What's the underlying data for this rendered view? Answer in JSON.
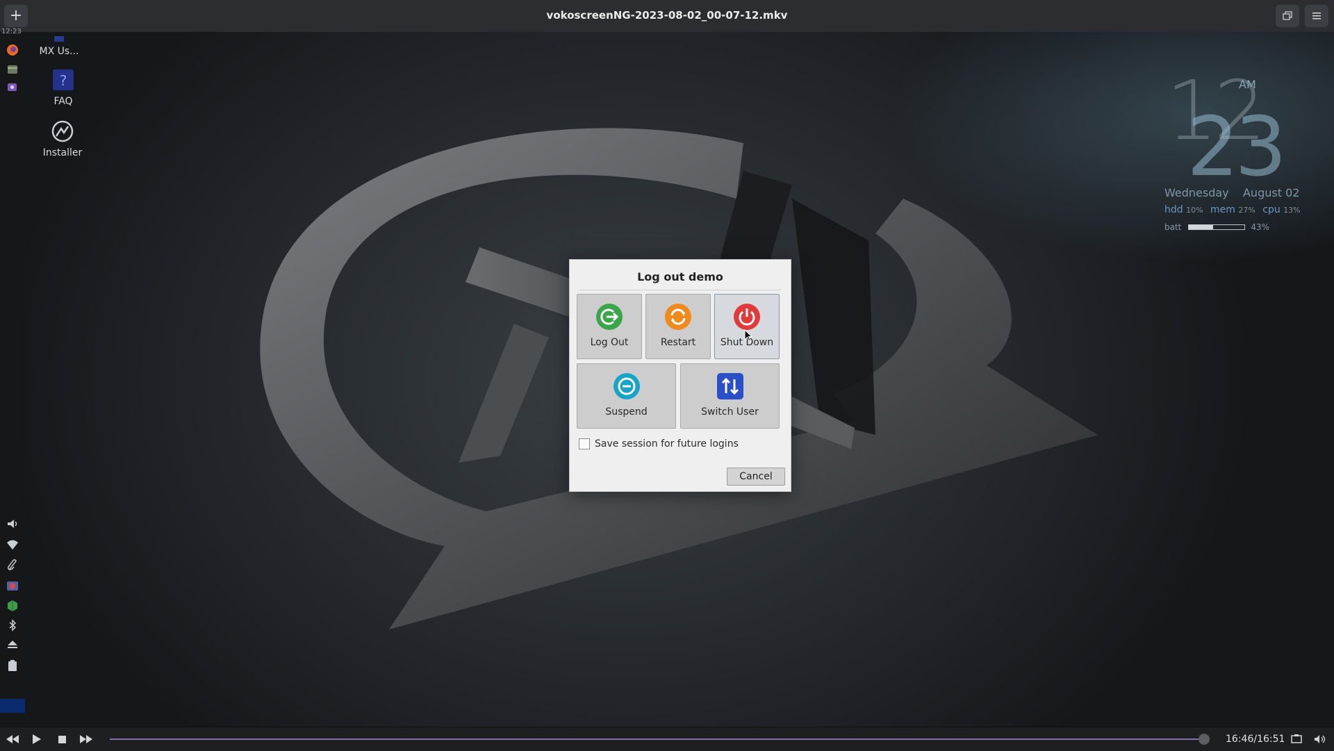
{
  "player": {
    "title": "vokoscreenNG-2023-08-02_00-07-12.mkv",
    "add_label": "+",
    "time": "16:46/16:51",
    "progress": 0.997
  },
  "panel": {
    "top_clock": "12:23"
  },
  "desktop": {
    "icons": [
      {
        "label": "MX Us...",
        "icon": "mx-user-manual-icon"
      },
      {
        "label": "FAQ",
        "icon": "faq-icon"
      },
      {
        "label": "Installer",
        "icon": "installer-icon"
      }
    ],
    "conky": {
      "hour": "12",
      "minute": "23",
      "ampm": "AM",
      "weekday": "Wednesday",
      "date": "August 02",
      "hdd_label": "hdd",
      "hdd_value": "10%",
      "mem_label": "mem",
      "mem_value": "27%",
      "cpu_label": "cpu",
      "cpu_value": "13%",
      "batt_label": "batt",
      "batt_value": "43%",
      "batt_level": 0.43
    }
  },
  "dialog": {
    "title": "Log out demo",
    "actions": [
      {
        "label": "Log Out",
        "icon": "logout-icon",
        "color": "#3aa64a"
      },
      {
        "label": "Restart",
        "icon": "restart-icon",
        "color": "#f08a1c"
      },
      {
        "label": "Shut Down",
        "icon": "power-icon",
        "color": "#e23a3a"
      },
      {
        "label": "Suspend",
        "icon": "suspend-icon",
        "color": "#18a3c9"
      },
      {
        "label": "Switch User",
        "icon": "switch-user-icon",
        "color": "#2b4fc9"
      }
    ],
    "save_session_label": "Save session for future logins",
    "save_session_checked": false,
    "cancel_label": "Cancel"
  }
}
